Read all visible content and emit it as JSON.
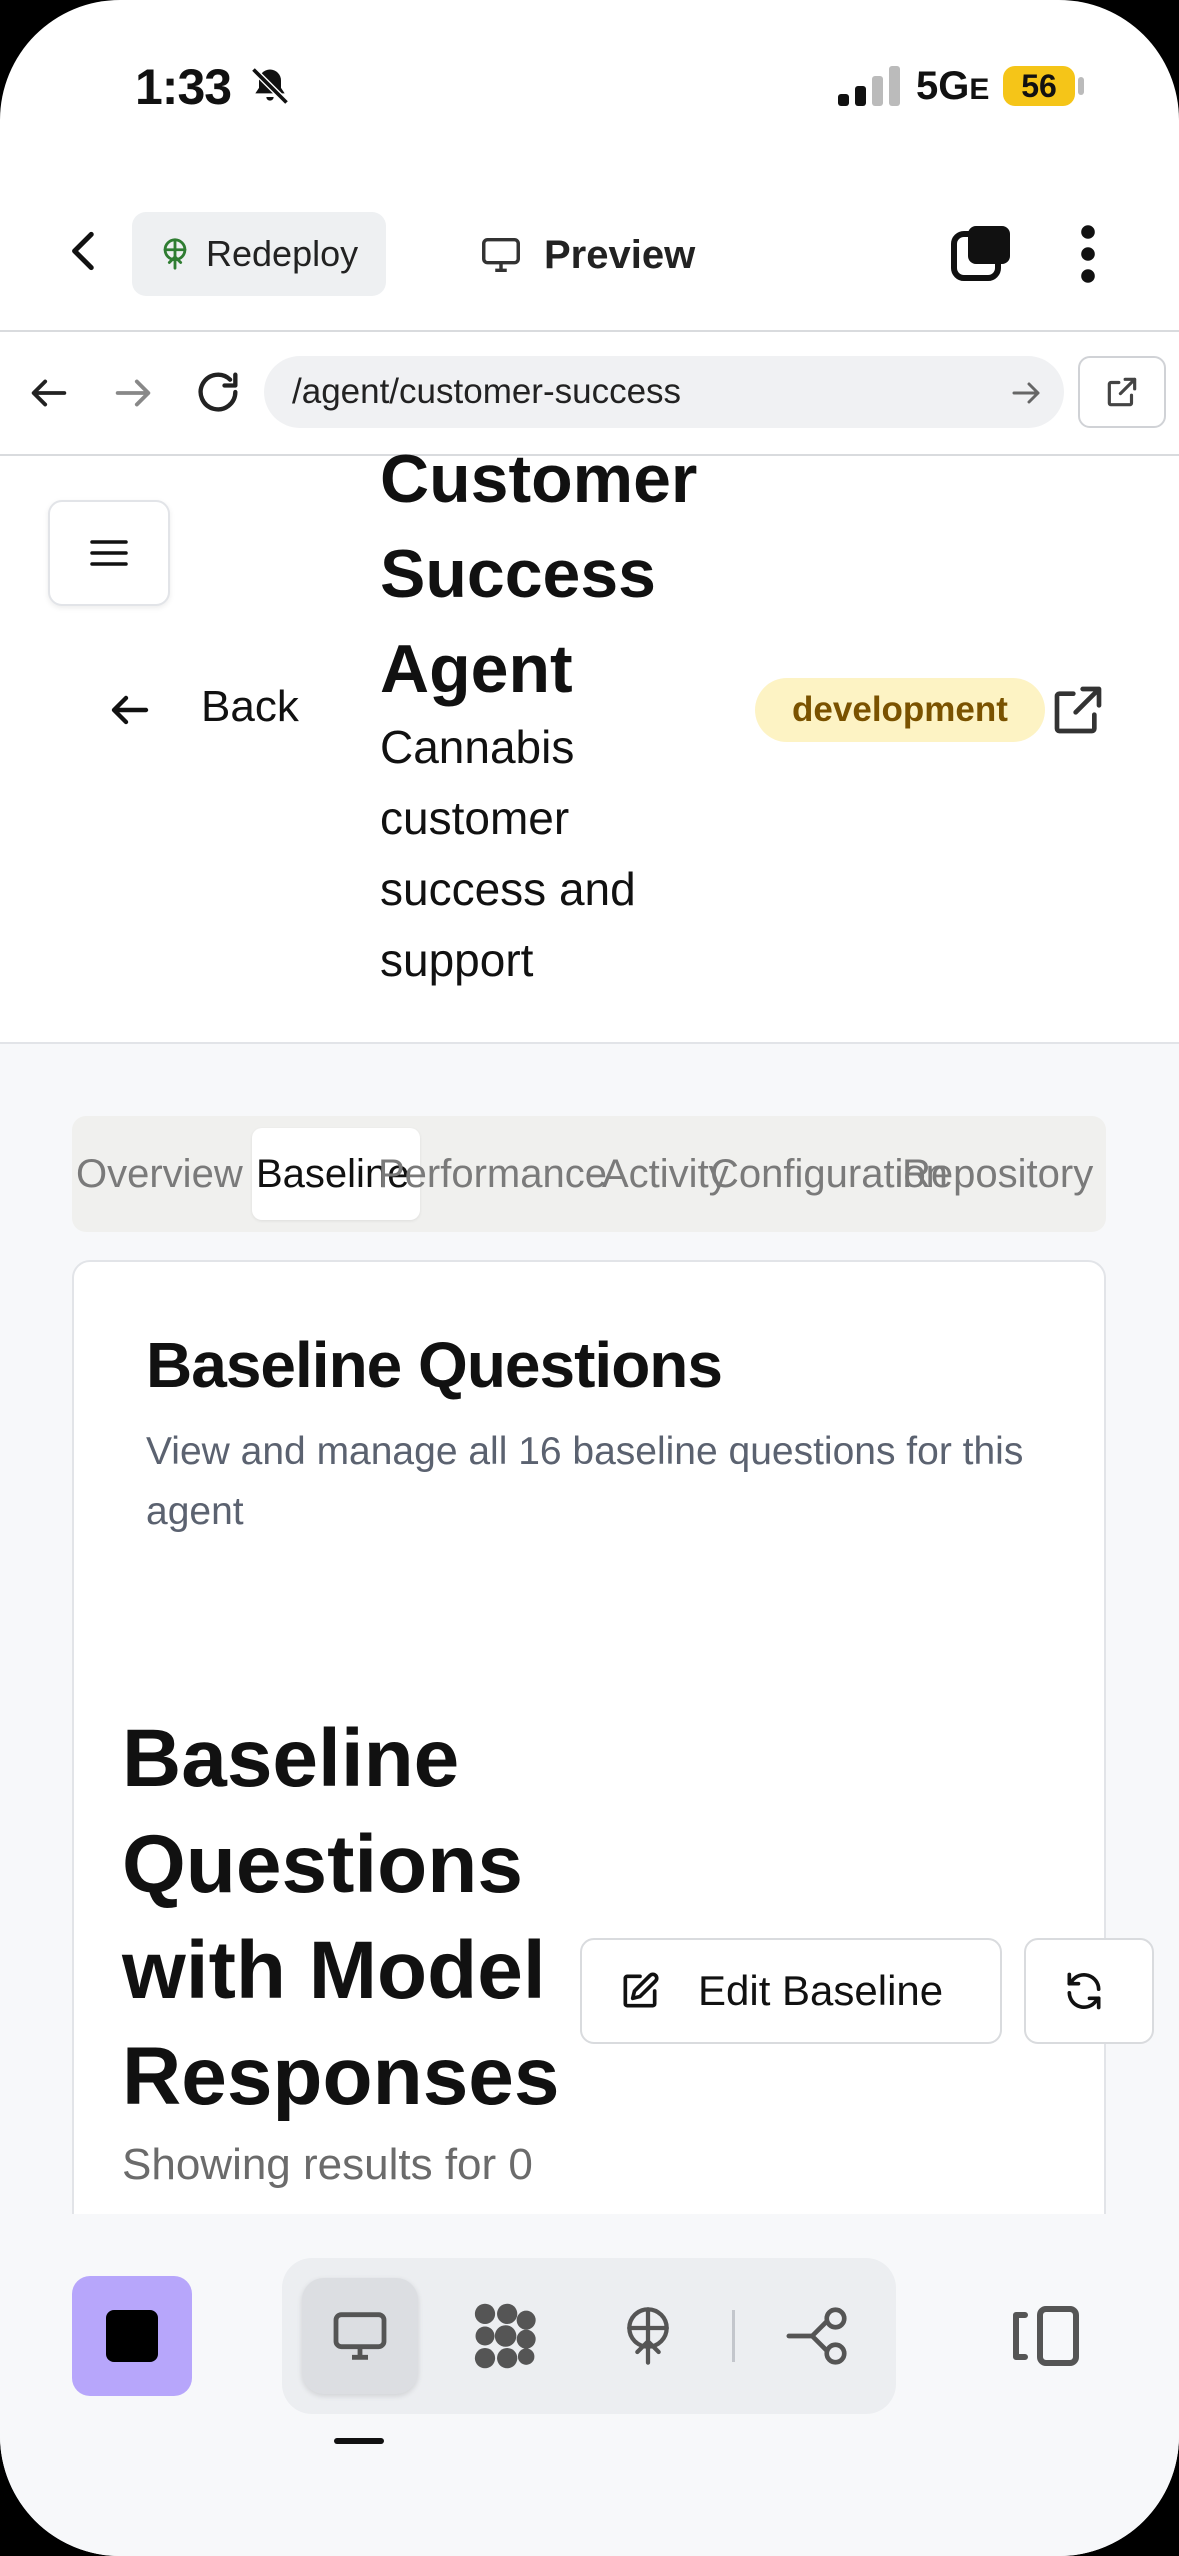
{
  "status_bar": {
    "time": "1:33",
    "network": "5G",
    "network_suffix": "E",
    "battery": "56"
  },
  "app_bar": {
    "redeploy_label": "Redeploy",
    "preview_label": "Preview"
  },
  "browser": {
    "url": "/agent/customer-success"
  },
  "header": {
    "back_label": "Back",
    "title": "Customer Success Agent",
    "subtitle": "Cannabis customer success and support",
    "badge": "development"
  },
  "tabs": [
    {
      "label": "Overview"
    },
    {
      "label": "Baseline"
    },
    {
      "label": "Performance"
    },
    {
      "label": "Activity"
    },
    {
      "label": "Configuration"
    },
    {
      "label": "Repository"
    }
  ],
  "card": {
    "title": "Baseline Questions",
    "description": "View and manage all 16 baseline questions for this agent",
    "section_title": "Baseline Questions with Model Responses",
    "edit_button": "Edit Baseline",
    "results_text": "Showing results for 0"
  },
  "toolbar": {
    "active_tool": "desktop"
  },
  "colors": {
    "accent": "#b7a6fb",
    "badge_bg": "#fdf3c4",
    "badge_text": "#7a5200"
  }
}
